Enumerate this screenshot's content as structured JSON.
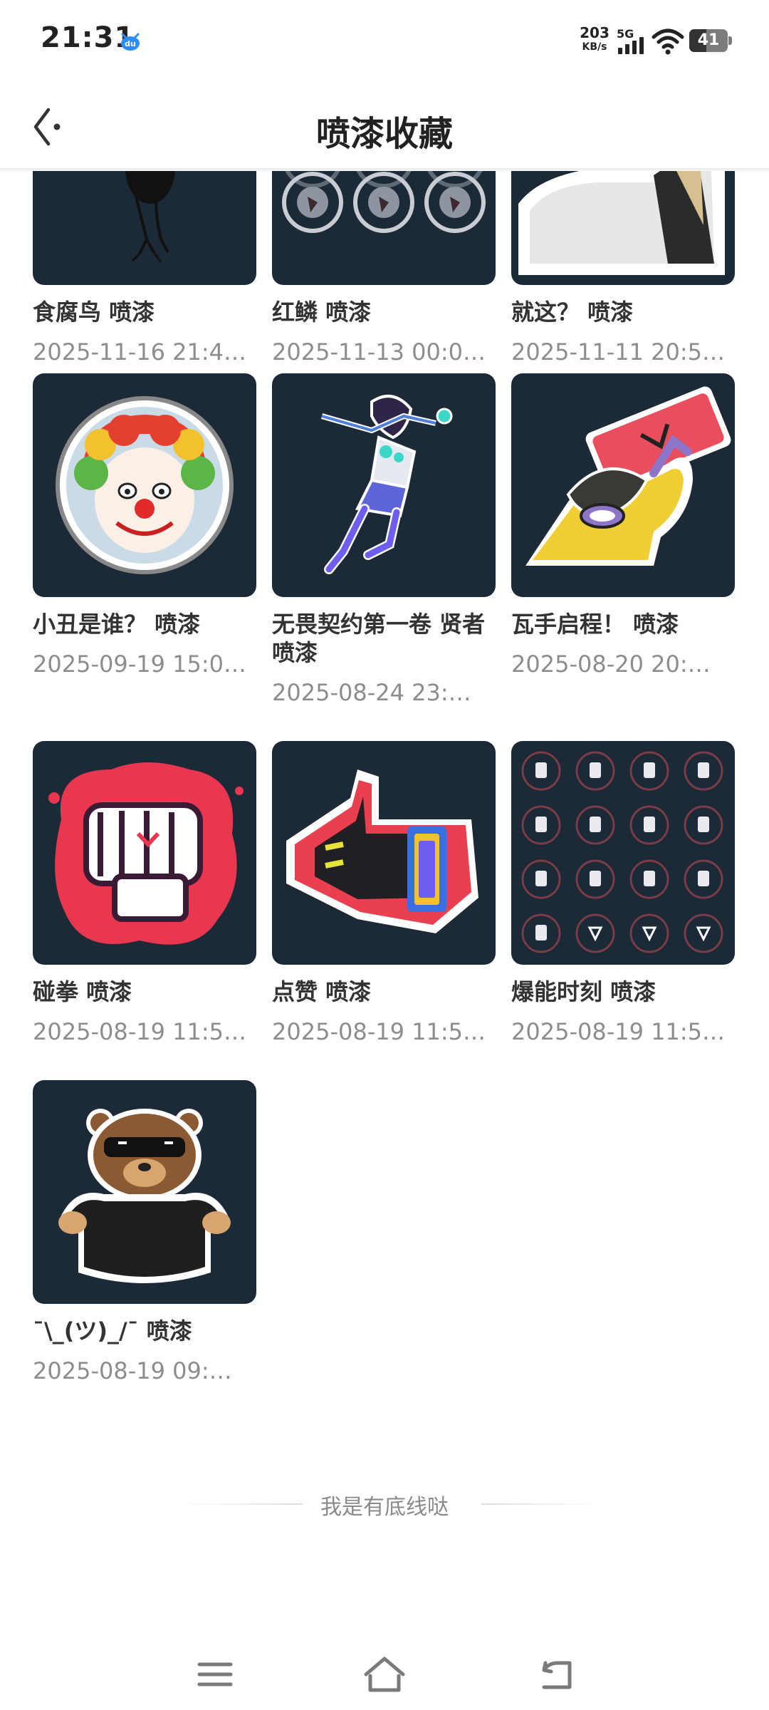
{
  "status": {
    "time": "21:31",
    "net_speed_value": "203",
    "net_speed_unit": "KB/s",
    "network_type": "5G",
    "battery": "41",
    "app_icon": "du-app-icon"
  },
  "header": {
    "title": "喷漆收藏",
    "back_icon": "back-arrow-icon"
  },
  "sprays": [
    {
      "title": "食腐鸟 喷漆",
      "date": "2025-11-16 21:4…"
    },
    {
      "title": "红鳞 喷漆",
      "date": "2025-11-13 00:0…"
    },
    {
      "title": "就这？ 喷漆",
      "date": "2025-11-11 20:5…"
    },
    {
      "title": "小丑是谁？ 喷漆",
      "date": "2025-09-19 15:0…"
    },
    {
      "title": "无畏契约第一卷 贤者 喷漆",
      "date": "2025-08-24 23:…"
    },
    {
      "title": "瓦手启程！ 喷漆",
      "date": "2025-08-20 20:…"
    },
    {
      "title": "碰拳 喷漆",
      "date": "2025-08-19 11:5…"
    },
    {
      "title": "点赞 喷漆",
      "date": "2025-08-19 11:5…"
    },
    {
      "title": "爆能时刻 喷漆",
      "date": "2025-08-19 11:5…"
    },
    {
      "title": "¯\\_(ツ)_/¯ 喷漆",
      "date": "2025-08-19 09:…"
    }
  ],
  "footer": {
    "end_text": "我是有底线哒"
  },
  "colors": {
    "thumb_bg": "#1c2937",
    "accent_red": "#e8374f"
  },
  "navbar": {
    "menu_icon": "menu-icon",
    "home_icon": "home-icon",
    "back_icon": "back-icon"
  }
}
